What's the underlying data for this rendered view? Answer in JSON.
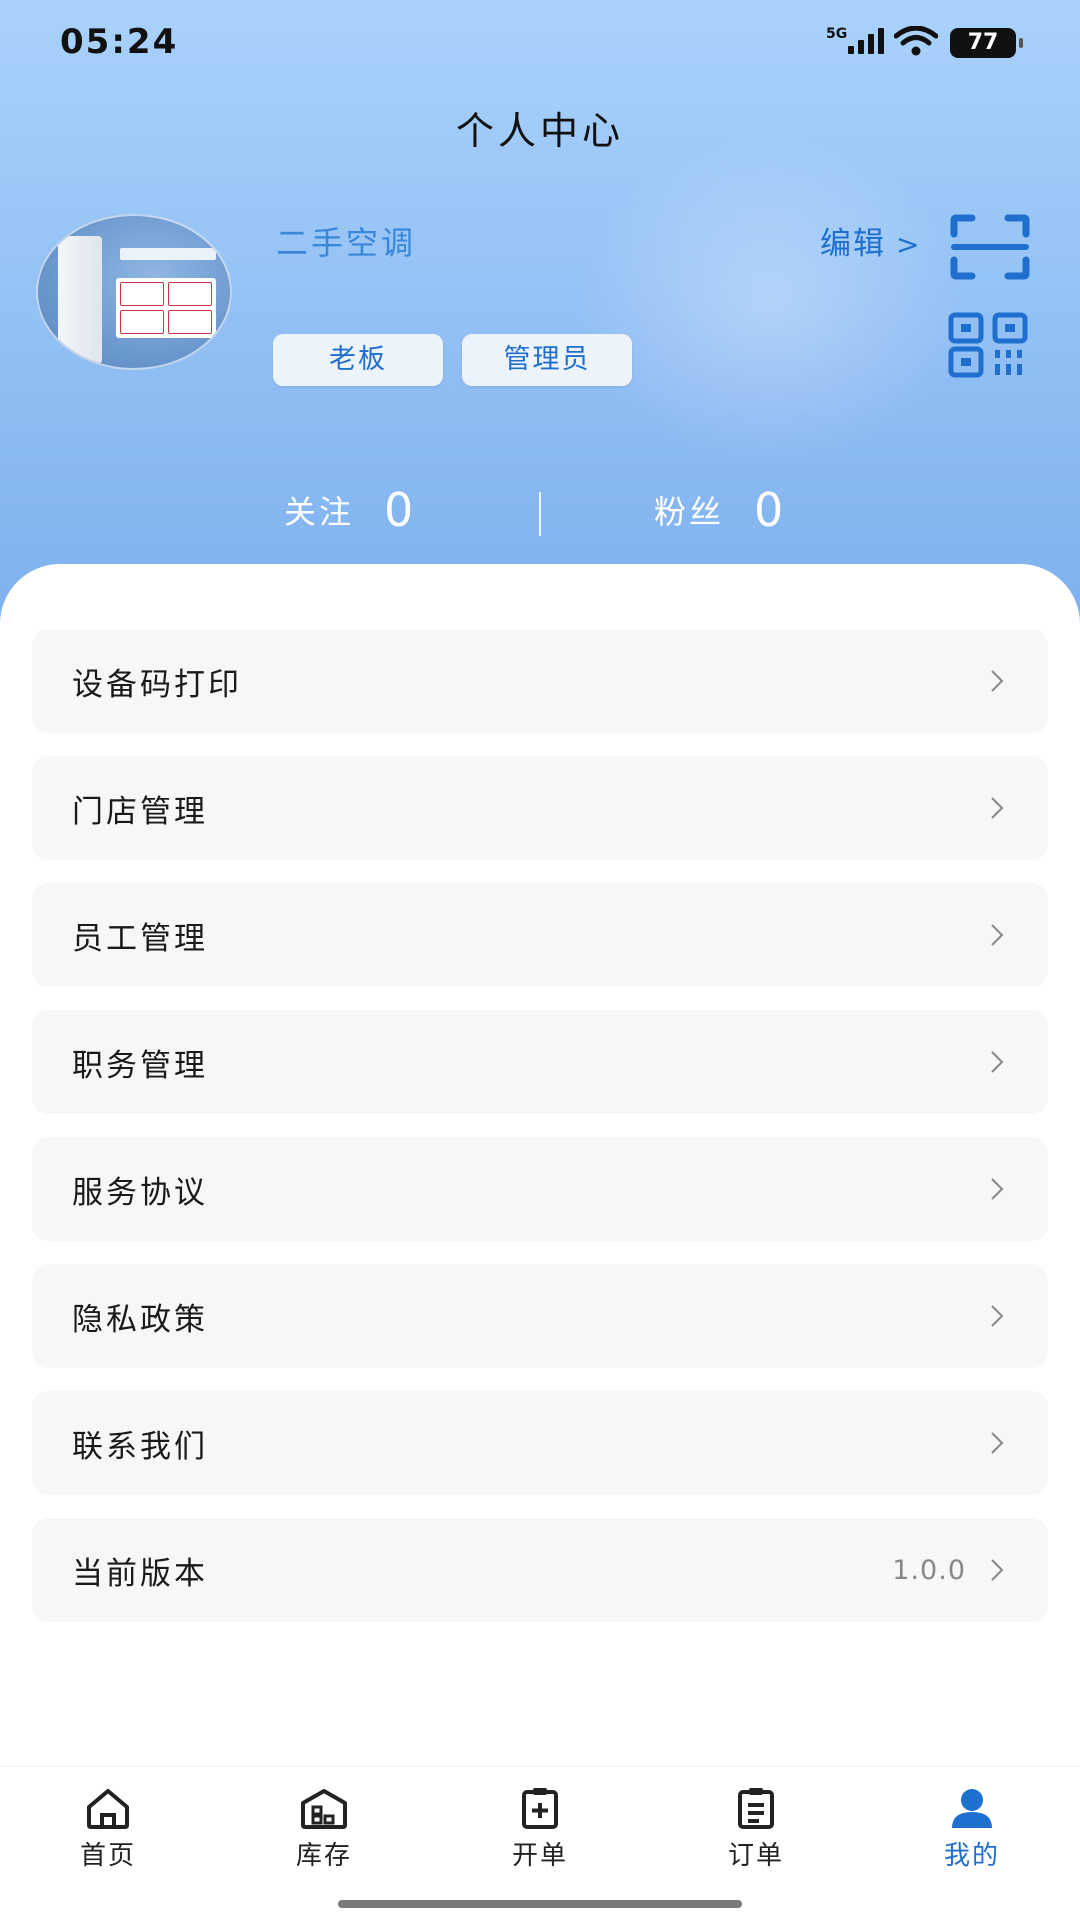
{
  "status_bar": {
    "time": "05:24",
    "network": "5G",
    "battery": "77"
  },
  "header": {
    "title": "个人中心"
  },
  "profile": {
    "name": "二手空调",
    "edit_label": "编辑",
    "edit_chevron": ">",
    "tags": [
      "老板",
      "管理员"
    ]
  },
  "stats": {
    "following": {
      "label": "关注",
      "value": "0"
    },
    "followers": {
      "label": "粉丝",
      "value": "0"
    }
  },
  "menu": [
    {
      "label": "设备码打印"
    },
    {
      "label": "门店管理"
    },
    {
      "label": "员工管理"
    },
    {
      "label": "职务管理"
    },
    {
      "label": "服务协议"
    },
    {
      "label": "隐私政策"
    },
    {
      "label": "联系我们"
    },
    {
      "label": "当前版本",
      "value": "1.0.0"
    }
  ],
  "tabbar": {
    "items": [
      {
        "label": "首页",
        "icon": "home-icon"
      },
      {
        "label": "库存",
        "icon": "warehouse-icon"
      },
      {
        "label": "开单",
        "icon": "add-clipboard-icon"
      },
      {
        "label": "订单",
        "icon": "clipboard-list-icon"
      },
      {
        "label": "我的",
        "icon": "user-icon",
        "active": true
      }
    ]
  },
  "colors": {
    "accent": "#1f6fcf",
    "header_gradient_top": "#a9d1fb",
    "header_gradient_bottom": "#7eb0ee"
  }
}
